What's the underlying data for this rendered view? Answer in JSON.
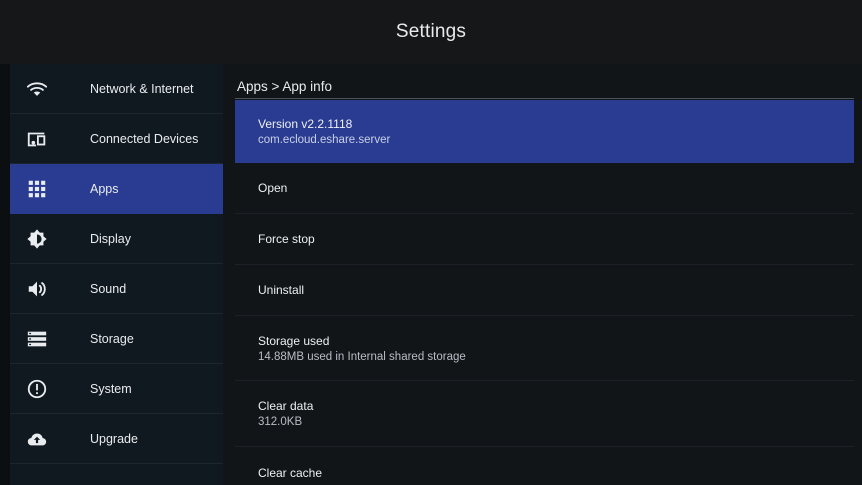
{
  "header": {
    "title": "Settings"
  },
  "sidebar": {
    "items": [
      {
        "label": "Network & Internet",
        "icon": "wifi-icon"
      },
      {
        "label": "Connected Devices",
        "icon": "connected-devices-icon"
      },
      {
        "label": "Apps",
        "icon": "apps-grid-icon",
        "active": true
      },
      {
        "label": "Display",
        "icon": "brightness-icon"
      },
      {
        "label": "Sound",
        "icon": "speaker-icon"
      },
      {
        "label": "Storage",
        "icon": "storage-icon"
      },
      {
        "label": "System",
        "icon": "info-alert-icon"
      },
      {
        "label": "Upgrade",
        "icon": "cloud-upload-icon"
      }
    ]
  },
  "main": {
    "breadcrumb": "Apps > App info",
    "rows": [
      {
        "title": "Version v2.2.1118",
        "subtitle": "com.ecloud.eshare.server",
        "selected": true
      },
      {
        "title": "Open"
      },
      {
        "title": "Force stop"
      },
      {
        "title": "Uninstall"
      },
      {
        "title": "Storage used",
        "subtitle": "14.88MB used in Internal shared storage"
      },
      {
        "title": "Clear data",
        "subtitle": "312.0KB"
      },
      {
        "title": "Clear cache"
      }
    ]
  },
  "colors": {
    "accent": "#293c92",
    "background": "#0c0f12",
    "sidebar": "#111920",
    "panel": "#111518",
    "text": "#e9ecef"
  }
}
